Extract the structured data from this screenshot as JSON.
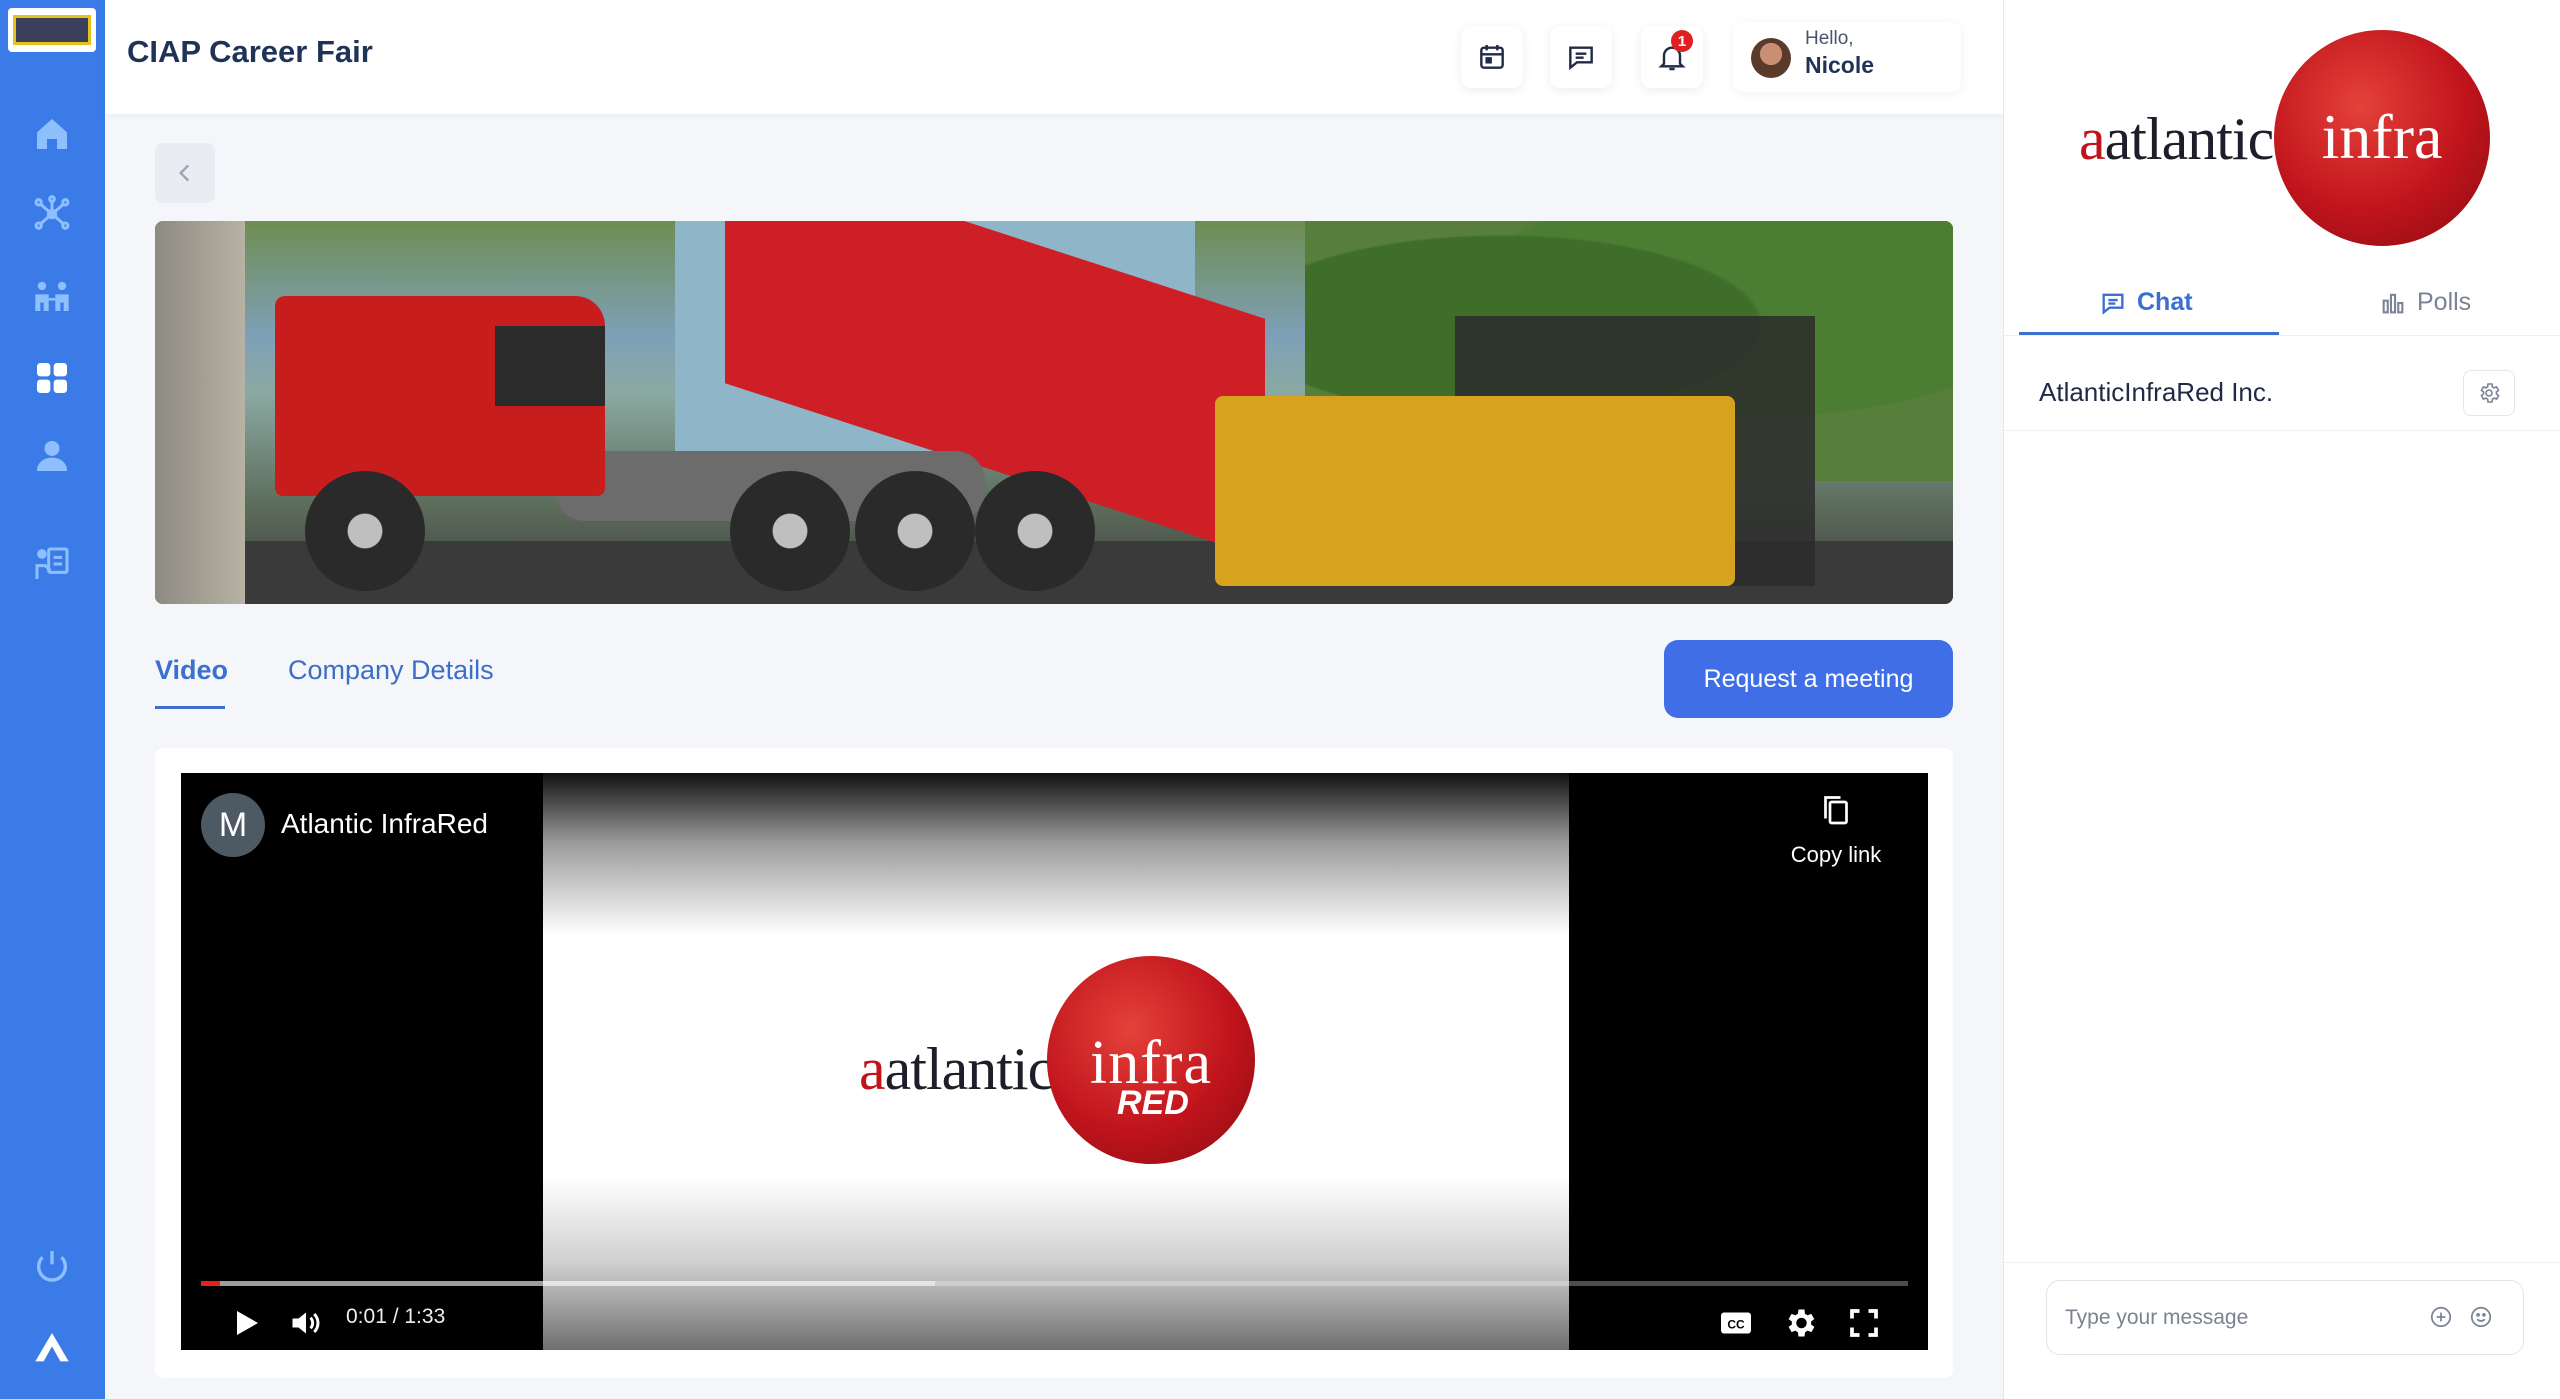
{
  "app": {
    "title": "CIAP Career Fair"
  },
  "header": {
    "greeting": "Hello,",
    "user_name": "Nicole",
    "notification_count": "1"
  },
  "sidebar": {
    "items": [
      {
        "icon": "home-icon"
      },
      {
        "icon": "network-icon"
      },
      {
        "icon": "networking-people-icon"
      },
      {
        "icon": "booths-grid-icon"
      },
      {
        "icon": "profile-icon"
      },
      {
        "icon": "lounge-icon"
      }
    ],
    "logout_icon": "power-icon",
    "brand_icon": "app-brand-icon"
  },
  "main": {
    "tabs": [
      {
        "label": "Video",
        "active": true
      },
      {
        "label": "Company Details",
        "active": false
      }
    ],
    "request_button": "Request a meeting"
  },
  "video": {
    "channel_initial": "M",
    "channel_name": "Atlantic InfraRed",
    "copy_link": "Copy link",
    "time": "0:01 / 1:33",
    "progress_fraction": 0.011,
    "buffered_fraction": 0.43,
    "logo": {
      "word1": "atlantic",
      "word2": "infra",
      "word3": "RED"
    }
  },
  "panel": {
    "logo": {
      "word1": "atlantic",
      "word2": "infra"
    },
    "tabs": [
      {
        "label": "Chat",
        "active": true
      },
      {
        "label": "Polls",
        "active": false
      }
    ],
    "room_name": "AtlanticInfraRed Inc.",
    "input_placeholder": "Type your message"
  },
  "colors": {
    "rail": "#3b7be8",
    "accent": "#3f6ee6",
    "brand_red": "#c0141c"
  }
}
